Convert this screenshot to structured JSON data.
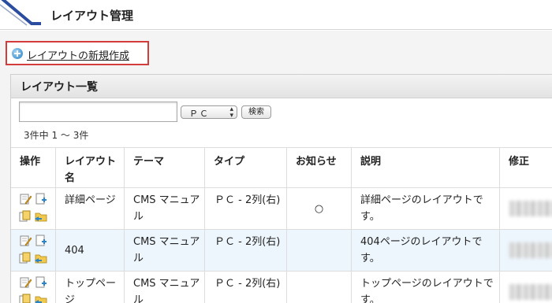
{
  "header": {
    "title": "レイアウト管理"
  },
  "new_link": {
    "label": "レイアウトの新規作成"
  },
  "panel": {
    "title": "レイアウト一覧"
  },
  "search": {
    "placeholder": "",
    "select_value": "ＰＣ",
    "button_label": "検索"
  },
  "count_text": "3件中 1 ～ 3件",
  "table": {
    "headers": {
      "ops": "操作",
      "name": "レイアウト名",
      "theme": "テーマ",
      "type": "タイプ",
      "notice": "お知らせ",
      "desc": "説明",
      "modified": "修正"
    },
    "rows": [
      {
        "name": "詳細ページ",
        "theme": "CMS マニュアル",
        "type": "ＰＣ - 2列(右)",
        "notice": "○",
        "desc": "詳細ページのレイアウトです。",
        "modified": ""
      },
      {
        "name": "404",
        "theme": "CMS マニュアル",
        "type": "ＰＣ - 2列(右)",
        "notice": "",
        "desc": "404ページのレイアウトです。",
        "modified": ""
      },
      {
        "name": "トップページ",
        "theme": "CMS マニュアル",
        "type": "ＰＣ - 2列(右)",
        "notice": "",
        "desc": "トップページのレイアウトです。",
        "modified": ""
      }
    ]
  }
}
